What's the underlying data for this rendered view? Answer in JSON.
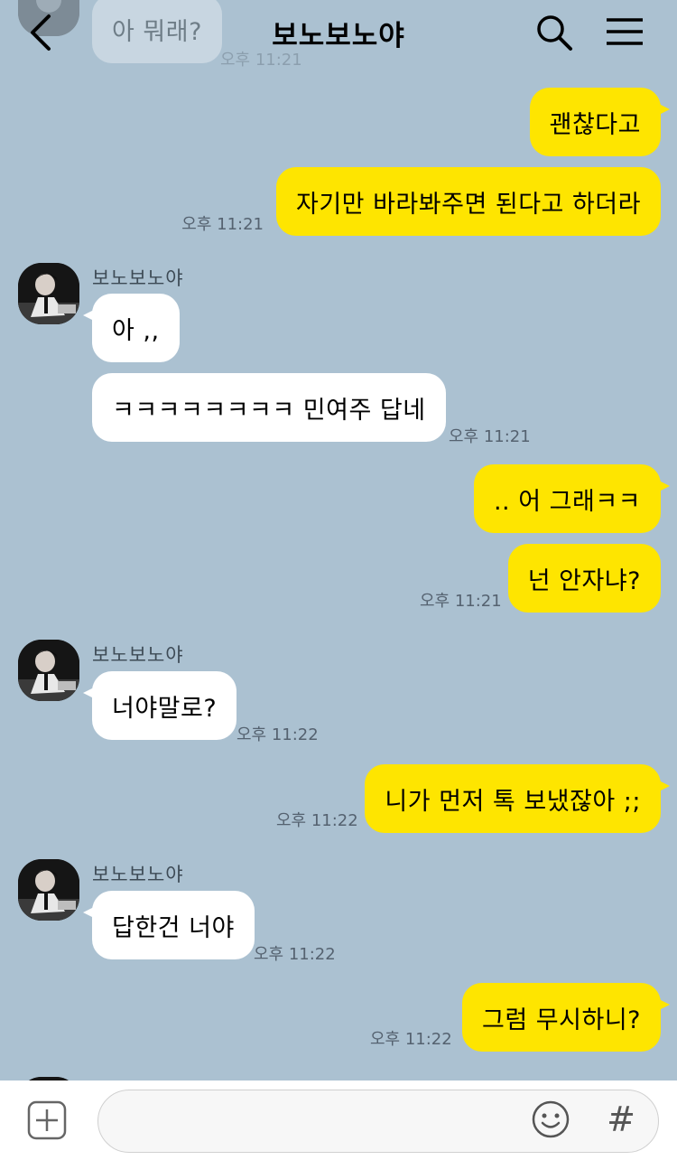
{
  "header": {
    "title": "보노보노야"
  },
  "messages": {
    "faded_prev": {
      "text": "아 뭐래?",
      "time": "오후 11:21"
    },
    "m1": {
      "text": "괜찮다고"
    },
    "m2": {
      "text": "자기만 바라봐주면 된다고 하더라",
      "time": "오후 11:21"
    },
    "g1": {
      "sender": "보노보노야",
      "msgs": [
        "아 ,,",
        "ㅋㅋㅋㅋㅋㅋㅋㅋ 민여주 답네"
      ],
      "time": "오후 11:21"
    },
    "m3": {
      "text": ".. 어 그래ㅋㅋ"
    },
    "m4": {
      "text": "넌 안자냐?",
      "time": "오후 11:21"
    },
    "g2": {
      "sender": "보노보노야",
      "msgs": [
        "너야말로?"
      ],
      "time": "오후 11:22"
    },
    "m5": {
      "text": "니가 먼저 톡 보냈잖아 ;;",
      "time": "오후 11:22"
    },
    "g3": {
      "sender": "보노보노야",
      "msgs": [
        "답한건 너야"
      ],
      "time": "오후 11:22"
    },
    "m6": {
      "text": "그럼 무시하니?",
      "time": "오후 11:22"
    }
  },
  "input": {
    "value": "",
    "placeholder": ""
  },
  "icons": {
    "back": "chevron-left-icon",
    "search": "search-icon",
    "menu": "menu-icon",
    "plus": "plus-square-icon",
    "emoji": "emoji-icon",
    "hash": "#"
  },
  "colors": {
    "background": "#abc1d1",
    "my_bubble": "#fee500",
    "other_bubble": "#ffffff"
  }
}
